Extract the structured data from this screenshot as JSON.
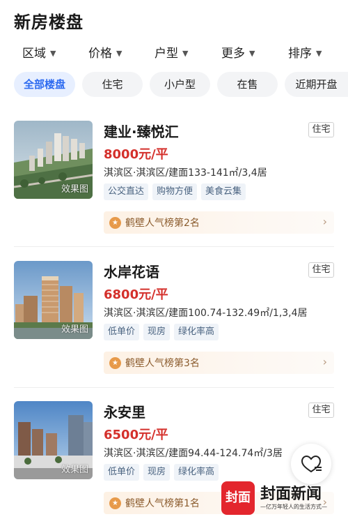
{
  "header": {
    "title": "新房楼盘"
  },
  "filters": [
    {
      "label": "区域",
      "icon": "chevron-down-icon"
    },
    {
      "label": "价格",
      "icon": "chevron-down-icon"
    },
    {
      "label": "户型",
      "icon": "chevron-down-icon"
    },
    {
      "label": "更多",
      "icon": "chevron-down-icon"
    },
    {
      "label": "排序",
      "icon": "chevron-down-icon"
    }
  ],
  "chips": [
    {
      "label": "全部楼盘",
      "active": true
    },
    {
      "label": "住宅",
      "active": false
    },
    {
      "label": "小户型",
      "active": false
    },
    {
      "label": "在售",
      "active": false
    },
    {
      "label": "近期开盘",
      "active": false
    }
  ],
  "listings": [
    {
      "name": "建业·臻悦汇",
      "type": "住宅",
      "price": "8000元/平",
      "info": "淇滨区·淇滨区/建面133-141㎡/3,4居",
      "tags": [
        "公交直达",
        "购物方便",
        "美食云集"
      ],
      "rank": "鹤壁人气榜第2名",
      "thumb_label": "效果图"
    },
    {
      "name": "水岸花语",
      "type": "住宅",
      "price": "6800元/平",
      "info": "淇滨区·淇滨区/建面100.74-132.49㎡/1,3,4居",
      "tags": [
        "低单价",
        "现房",
        "绿化率高"
      ],
      "rank": "鹤壁人气榜第3名",
      "thumb_label": "效果图"
    },
    {
      "name": "永安里",
      "type": "住宅",
      "price": "6500元/平",
      "info": "淇滨区·淇滨区/建面94.44-124.74㎡/3居",
      "tags": [
        "低单价",
        "现房",
        "绿化率高"
      ],
      "rank": "鹤壁人气榜第1名",
      "thumb_label": "效果图"
    }
  ],
  "favorite": {
    "icon": "heart-list-icon"
  },
  "watermark": {
    "logo": "封面",
    "brand": "封面新闻",
    "slogan": "—亿万年轻人的生活方式—"
  },
  "colors": {
    "accent": "#2d6bf0",
    "price": "#d4302b",
    "rank_text": "#8a5a2b",
    "brand_red": "#e3262d"
  }
}
